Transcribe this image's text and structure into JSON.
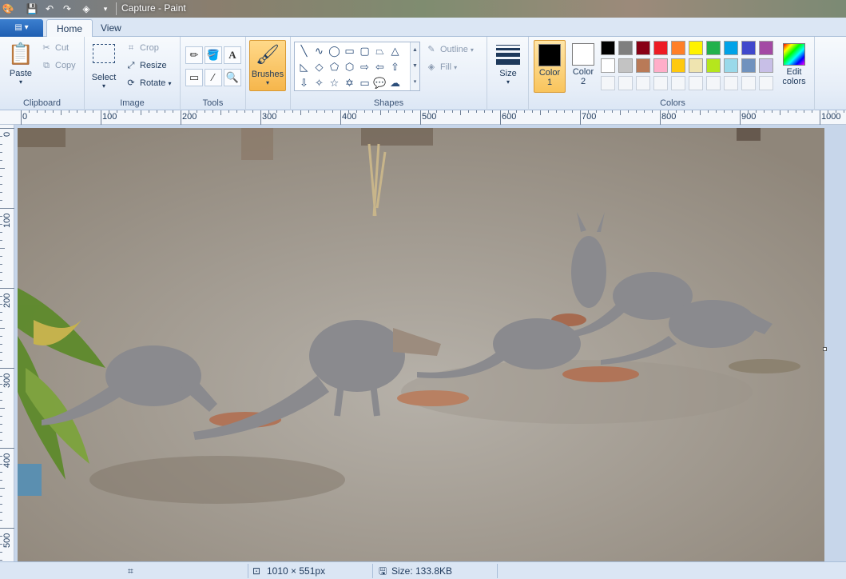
{
  "window": {
    "title": "Capture - Paint"
  },
  "tabs": [
    {
      "label": "Home"
    },
    {
      "label": "View"
    }
  ],
  "ribbon": {
    "clipboard": {
      "label": "Clipboard",
      "paste": "Paste",
      "cut": "Cut",
      "copy": "Copy"
    },
    "image": {
      "label": "Image",
      "select": "Select",
      "crop": "Crop",
      "resize": "Resize",
      "rotate": "Rotate"
    },
    "tools": {
      "label": "Tools"
    },
    "brushes": {
      "label": "Brushes"
    },
    "shapes": {
      "label": "Shapes",
      "outline": "Outline",
      "fill": "Fill"
    },
    "size": {
      "label": "Size"
    },
    "color1": {
      "label1": "Color",
      "label2": "1",
      "value": "#000000"
    },
    "color2": {
      "label1": "Color",
      "label2": "2",
      "value": "#ffffff"
    },
    "colors": {
      "label": "Colors",
      "row1": [
        "#000000",
        "#7f7f7f",
        "#880015",
        "#ed1c24",
        "#ff7f27",
        "#fff200",
        "#22b14c",
        "#00a2e8",
        "#3f48cc",
        "#a349a4"
      ],
      "row2": [
        "#ffffff",
        "#c3c3c3",
        "#b97a57",
        "#ffaec9",
        "#ffc90e",
        "#efe4b0",
        "#b5e61d",
        "#99d9ea",
        "#7092be",
        "#c8bfe7"
      ]
    },
    "edit_colors": {
      "label1": "Edit",
      "label2": "colors"
    }
  },
  "ruler": {
    "h_labels": [
      "0",
      "100",
      "200",
      "300",
      "400",
      "500",
      "600",
      "700",
      "800",
      "900",
      "1000"
    ],
    "v_labels": [
      "0",
      "100",
      "200",
      "300",
      "400",
      "500"
    ]
  },
  "status": {
    "dimensions": "1010 × 551px",
    "size": "Size: 133.8KB"
  }
}
